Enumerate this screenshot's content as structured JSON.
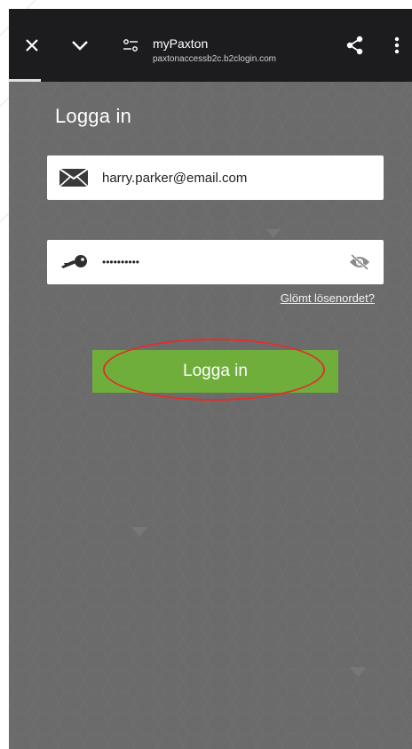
{
  "browser": {
    "site_title": "myPaxton",
    "site_url": "paxtonaccessb2c.b2clogin.com",
    "icons": {
      "close": "close-icon",
      "collapse": "chevron-down-icon",
      "site_settings": "tune-icon",
      "share": "share-icon",
      "menu": "more-vert-icon"
    }
  },
  "login": {
    "heading": "Logga in",
    "email_value": "harry.parker@email.com",
    "password_value": "••••••••••",
    "forgot_link": "Glömt lösenordet?",
    "submit_label": "Logga in",
    "icons": {
      "email": "envelope-icon",
      "password": "key-icon",
      "visibility": "eye-off-icon"
    }
  },
  "colors": {
    "toolbar": "#1c1c1e",
    "background": "#6b6b6b",
    "button": "#6fae3b",
    "annotation": "#e0302a"
  }
}
